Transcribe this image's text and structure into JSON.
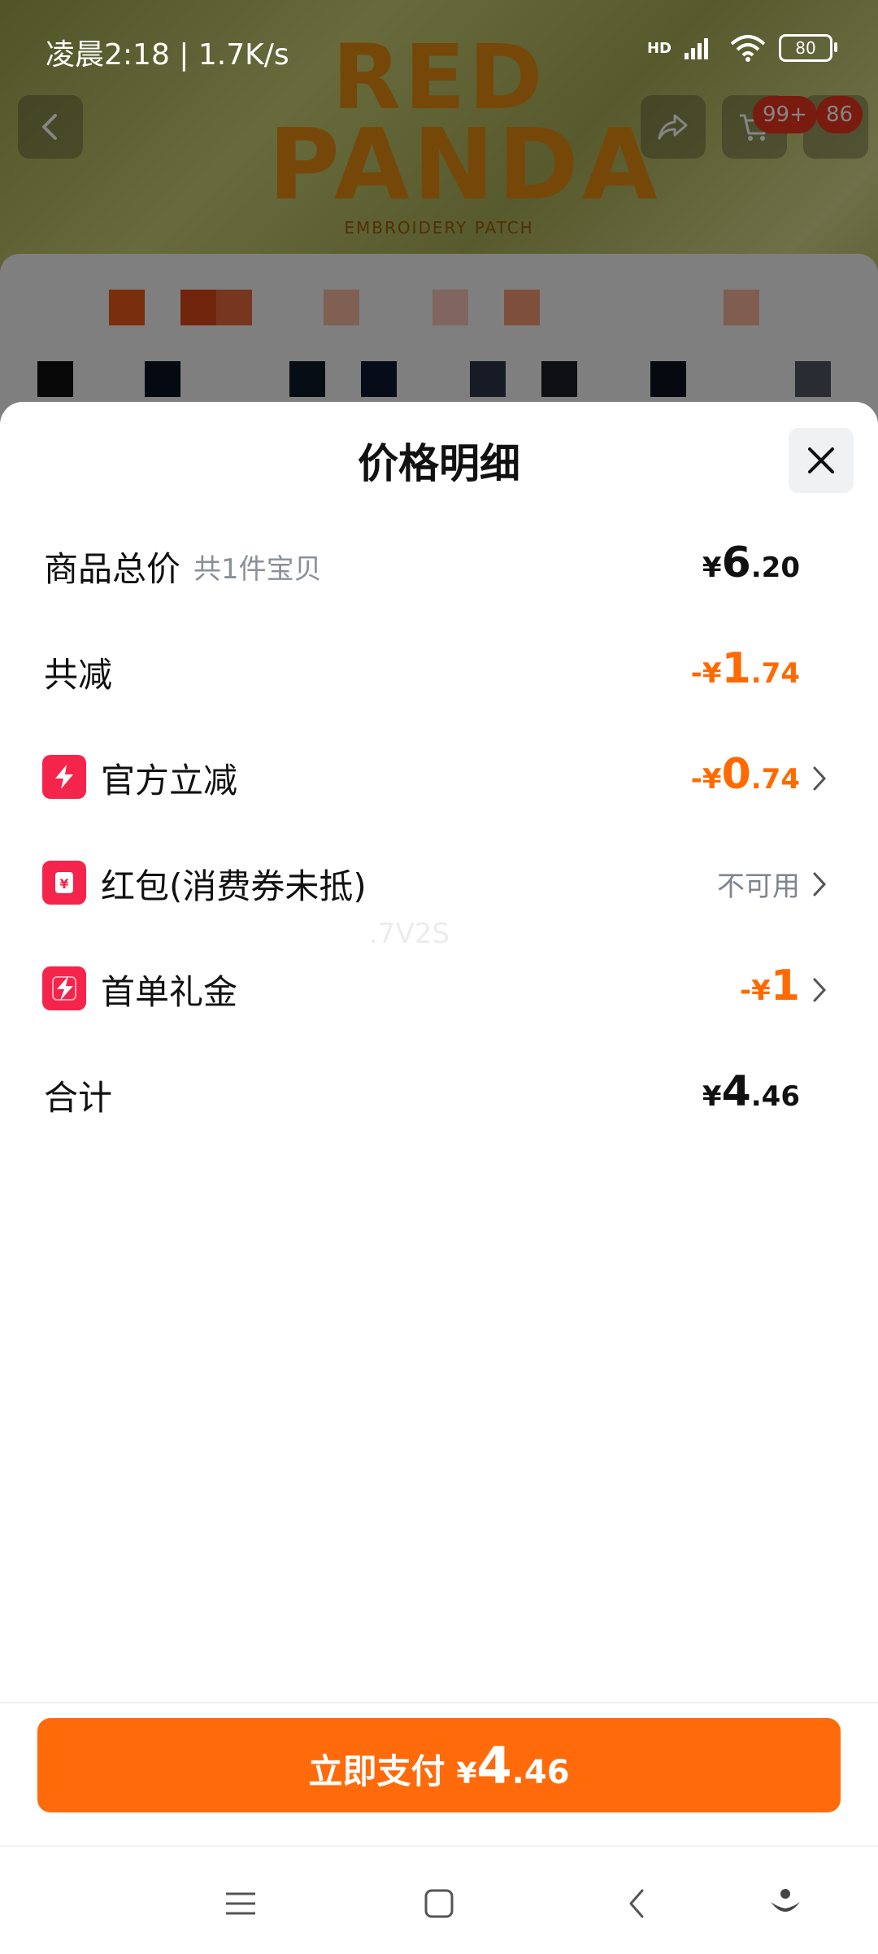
{
  "status_bar": {
    "time": "凌晨2:18 | 1.7K/s",
    "network": "HD",
    "battery": "80"
  },
  "background_page": {
    "brand_line1": "RED",
    "brand_line2": "PANDA",
    "brand_sub": "EMBROIDERY PATCH",
    "cart_badge": "99+",
    "message_badge": "86"
  },
  "sheet": {
    "title": "价格明细",
    "rows": [
      {
        "label": "商品总价",
        "hint": "共1件宝贝",
        "sym": "¥",
        "int": "6",
        "dec": ".20"
      },
      {
        "label": "共减",
        "sym": "-¥",
        "int": "1",
        "dec": ".74"
      },
      {
        "label": "官方立减",
        "sym": "-¥",
        "int": "0",
        "dec": ".74"
      },
      {
        "label": "红包(消费券未抵)",
        "value": "不可用"
      },
      {
        "label": "首单礼金",
        "sym": "-¥",
        "int": "1",
        "dec": ""
      },
      {
        "label": "合计",
        "sym": "¥",
        "int": "4",
        "dec": ".46"
      }
    ],
    "watermark": ".7V2S"
  },
  "pay_button": {
    "label": "立即支付",
    "sym": "¥",
    "int": "4",
    "dec": ".46"
  },
  "colors": {
    "accent": "#ff6a0a",
    "icon_red": "#f5244a",
    "text_dark": "#111111",
    "text_muted": "#8a9099"
  },
  "icons": [
    "back-arrow-icon",
    "share-icon",
    "cart-icon",
    "more-icon",
    "wifi-icon",
    "signal-icon",
    "battery-icon",
    "close-icon",
    "lightning-icon",
    "red-packet-icon",
    "gift-money-icon",
    "chevron-right-icon",
    "menu-icon",
    "home-icon",
    "back-icon",
    "assistant-icon"
  ]
}
